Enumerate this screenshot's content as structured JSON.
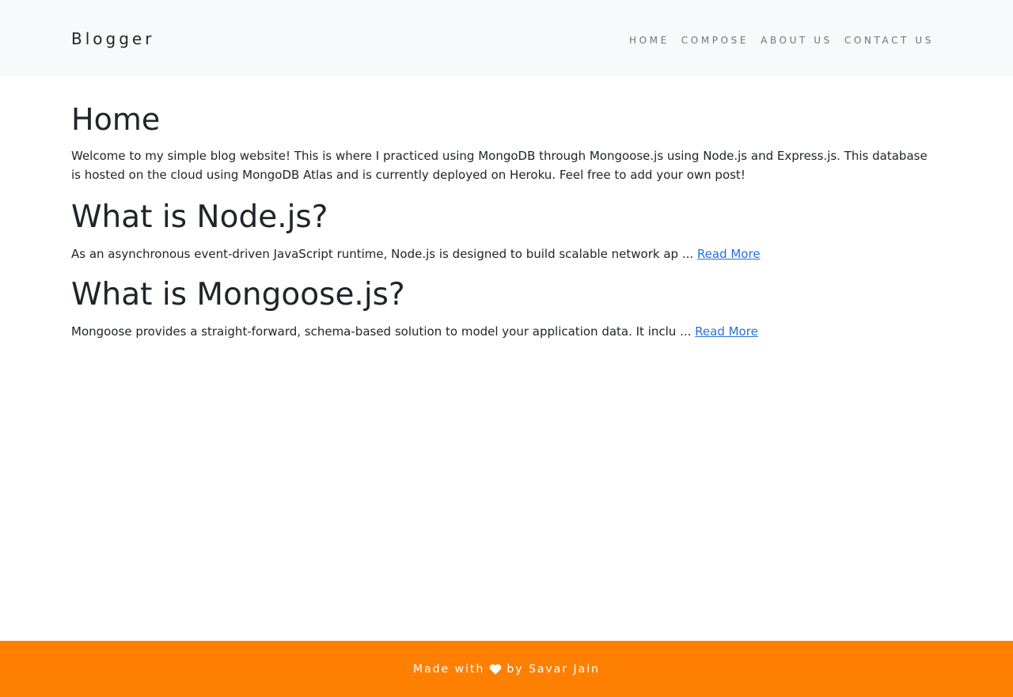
{
  "brand": "Blogger",
  "nav": {
    "items": [
      "HOME",
      "COMPOSE",
      "ABOUT US",
      "CONTACT US"
    ]
  },
  "main": {
    "title": "Home",
    "intro": "Welcome to my simple blog website! This is where I practiced using MongoDB through Mongoose.js using Node.js and Express.js. This database is hosted on the cloud using MongoDB Atlas and is currently deployed on Heroku. Feel free to add your own post!",
    "posts": [
      {
        "title": "What is Node.js?",
        "excerpt": "As an asynchronous event-driven JavaScript runtime, Node.js is designed to build scalable network ap ... ",
        "link_label": "Read More"
      },
      {
        "title": "What is Mongoose.js?",
        "excerpt": "Mongoose provides a straight-forward, schema-based solution to model your application data. It inclu ... ",
        "link_label": "Read More"
      }
    ]
  },
  "footer": {
    "before": "Made with",
    "icon": "heart-icon",
    "after": "by Savar Jain",
    "bg_color": "#ff7f00"
  }
}
